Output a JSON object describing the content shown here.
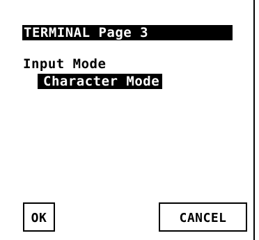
{
  "header": {
    "title": "TERMINAL Page 3"
  },
  "input_mode": {
    "label": "Input Mode",
    "value": "Character Mode"
  },
  "buttons": {
    "ok_label": "OK",
    "cancel_label": "CANCEL"
  }
}
